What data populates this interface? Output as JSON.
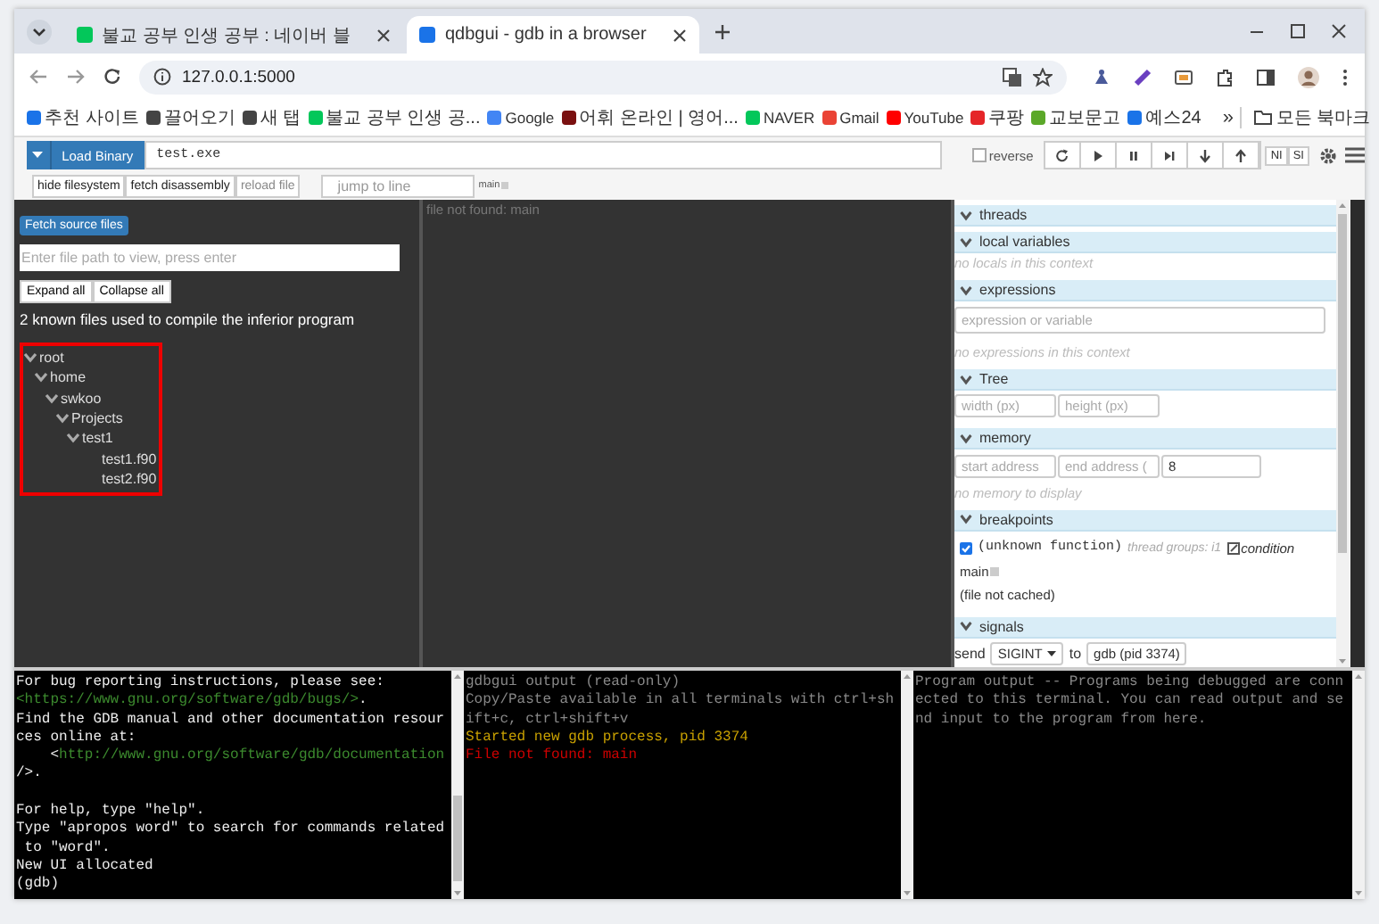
{
  "browser": {
    "tabs": [
      {
        "title": "불교 공부 인생 공부 : 네이버 블",
        "selected": false,
        "color": "#03c75a"
      },
      {
        "title": "qdbgui - gdb in a browser",
        "selected": true,
        "color": "#1a73e8"
      }
    ],
    "address": "127.0.0.1:5000",
    "bookmarks": [
      {
        "label": "추천 사이트",
        "color": "#1a73e8"
      },
      {
        "label": "끌어오기",
        "color": "#444444"
      },
      {
        "label": "새 탭",
        "color": "#444444"
      },
      {
        "label": "불교 공부 인생 공...",
        "color": "#03c75a"
      },
      {
        "label": "Google",
        "color": "#4285f4"
      },
      {
        "label": "어휘 온라인 | 영어...",
        "color": "#7a1010"
      },
      {
        "label": "NAVER",
        "color": "#03c75a"
      },
      {
        "label": "Gmail",
        "color": "#ea4335"
      },
      {
        "label": "YouTube",
        "color": "#ff0000"
      },
      {
        "label": "쿠팡",
        "color": "#e52528"
      },
      {
        "label": "교보문고",
        "color": "#5ba829"
      },
      {
        "label": "예스24",
        "color": "#1a73e8"
      }
    ],
    "overflow": "»",
    "all_bookmarks": "모든 북마크"
  },
  "toolbar": {
    "load_button": "Load Binary",
    "binary_path": "test.exe",
    "reverse": {
      "label": "reverse",
      "checked": false
    },
    "step_buttons": [
      "NI",
      "SI"
    ]
  },
  "subbar": {
    "buttons": [
      {
        "label": "hide filesystem",
        "disabled": false
      },
      {
        "label": "fetch disassembly",
        "disabled": false
      },
      {
        "label": "reload file",
        "disabled": true
      }
    ],
    "jump_placeholder": "jump to line",
    "function": "main"
  },
  "file_panel": {
    "fetch_button": "Fetch source files",
    "path_placeholder": "Enter file path to view, press enter",
    "expand_button": "Expand all",
    "collapse_button": "Collapse all",
    "info": "2 known files used to compile the inferior program",
    "tree": {
      "highlighted": true,
      "nodes": [
        {
          "label": "root",
          "expanded": true,
          "children": [
            {
              "label": "home",
              "expanded": true,
              "children": [
                {
                  "label": "swkoo",
                  "expanded": true,
                  "children": [
                    {
                      "label": "Projects",
                      "expanded": true,
                      "children": [
                        {
                          "label": "test1",
                          "expanded": true,
                          "children": [
                            {
                              "label": "test1.f90"
                            },
                            {
                              "label": "test2.f90"
                            }
                          ]
                        }
                      ]
                    }
                  ]
                }
              ]
            }
          ]
        }
      ]
    }
  },
  "source": {
    "message": "file not found: main"
  },
  "sections": [
    {
      "kind": "header",
      "title": "threads",
      "expanded": true
    },
    {
      "kind": "note",
      "title": "local variables",
      "expanded": true,
      "note": "no locals in this context"
    },
    {
      "kind": "expressions",
      "title": "expressions",
      "expanded": true,
      "placeholder": "expression or variable",
      "note": "no expressions in this context"
    },
    {
      "kind": "inputs",
      "title": "Tree",
      "expanded": true,
      "fields": [
        {
          "placeholder": "width (px)"
        },
        {
          "placeholder": "height (px)"
        }
      ]
    },
    {
      "kind": "inputs",
      "title": "memory",
      "expanded": true,
      "fields": [
        {
          "placeholder": "start address"
        },
        {
          "placeholder": "end address ("
        },
        {
          "value": "8"
        }
      ],
      "note": "no memory to display"
    },
    {
      "kind": "breakpoints",
      "title": "breakpoints",
      "expanded": true,
      "breakpoint": {
        "enabled": true,
        "function": "(unknown function)",
        "threads": "thread groups: i1",
        "condition": "condition",
        "location": "main",
        "status": "(file not cached)"
      }
    },
    {
      "kind": "signals",
      "title": "signals",
      "expanded": true,
      "send": "send",
      "signal": "SIGINT",
      "to": "to",
      "target": "gdb (pid 3374)"
    }
  ],
  "terminals": [
    {
      "lines": [
        [
          {
            "kind": "plain",
            "text": "For bug reporting instructions, please see:"
          }
        ],
        [
          {
            "kind": "link",
            "text": "<https://www.gnu.org/software/gdb/bugs/>"
          },
          {
            "kind": "plain",
            "text": "."
          }
        ],
        [
          {
            "kind": "plain",
            "text": "Find the GDB manual and other documentation resour"
          }
        ],
        [
          {
            "kind": "plain",
            "text": "ces online at:"
          }
        ],
        [
          {
            "kind": "plain",
            "text": "    <"
          },
          {
            "kind": "link",
            "text": "http://www.gnu.org/software/gdb/documentation"
          }
        ],
        [
          {
            "kind": "plain",
            "text": "/>."
          }
        ],
        [
          {
            "kind": "gap"
          },
          {
            "kind": "plain",
            "text": "For help, type \"help\"."
          }
        ],
        [
          {
            "kind": "plain",
            "text": "Type \"apropos word\" to search for commands related"
          }
        ],
        [
          {
            "kind": "plain",
            "text": " to \"word\"."
          }
        ],
        [
          {
            "kind": "plain",
            "text": "New UI allocated"
          }
        ],
        [
          {
            "kind": "plain",
            "text": "(gdb)"
          }
        ]
      ]
    },
    {
      "lines": [
        [
          {
            "kind": "muted",
            "text": "gdbgui output (read-only)"
          }
        ],
        [
          {
            "kind": "muted",
            "text": "Copy/Paste available in all terminals with ctrl+sh"
          }
        ],
        [
          {
            "kind": "muted",
            "text": "ift+c, ctrl+shift+v"
          }
        ],
        [
          {
            "kind": "warning",
            "text": "Started new gdb process, pid 3374"
          }
        ],
        [
          {
            "kind": "error",
            "text": "File not found: main"
          }
        ]
      ]
    },
    {
      "lines": [
        [
          {
            "kind": "muted",
            "text": "Program output -- Programs being debugged are conn"
          }
        ],
        [
          {
            "kind": "muted",
            "text": "ected to this terminal. You can read output and se"
          }
        ],
        [
          {
            "kind": "muted",
            "text": "nd input to the program from here."
          }
        ]
      ]
    }
  ]
}
